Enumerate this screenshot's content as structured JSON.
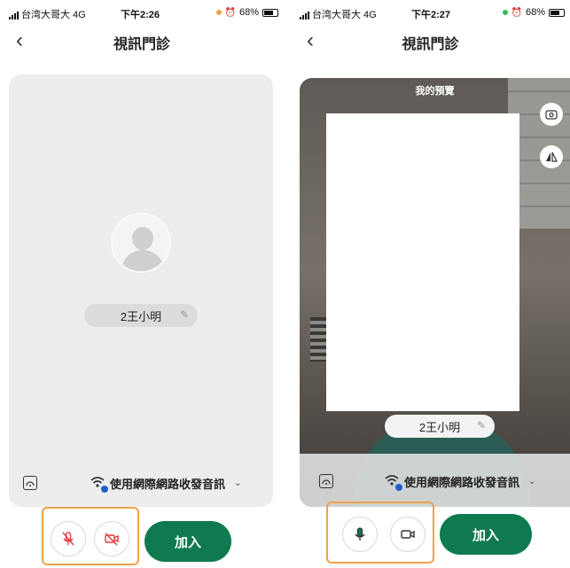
{
  "colors": {
    "accent_green": "#0f7a4f",
    "highlight_orange": "#f0a24b",
    "mic_off_red": "#e23b3b",
    "badge_blue": "#1e62c8"
  },
  "screen_a": {
    "status": {
      "carrier": "台湾大哥大 4G",
      "time": "下午2:26",
      "battery": "68%"
    },
    "nav": {
      "back_icon": "chevron-left-icon",
      "title": "視訊門診"
    },
    "participant": {
      "name": "2王小明"
    },
    "network_text": "使用網際網路收發音訊",
    "join_label": "加入",
    "mic_state": "muted",
    "camera_state": "off"
  },
  "screen_b": {
    "status": {
      "carrier": "台湾大哥大 4G",
      "time": "下午2:27",
      "battery": "68%"
    },
    "nav": {
      "back_icon": "chevron-left-icon",
      "title": "視訊門診"
    },
    "preview_label": "我的預覽",
    "participant": {
      "name": "2王小明"
    },
    "network_text": "使用網際網路收發音訊",
    "join_label": "加入",
    "mic_state": "on",
    "camera_state": "on"
  }
}
